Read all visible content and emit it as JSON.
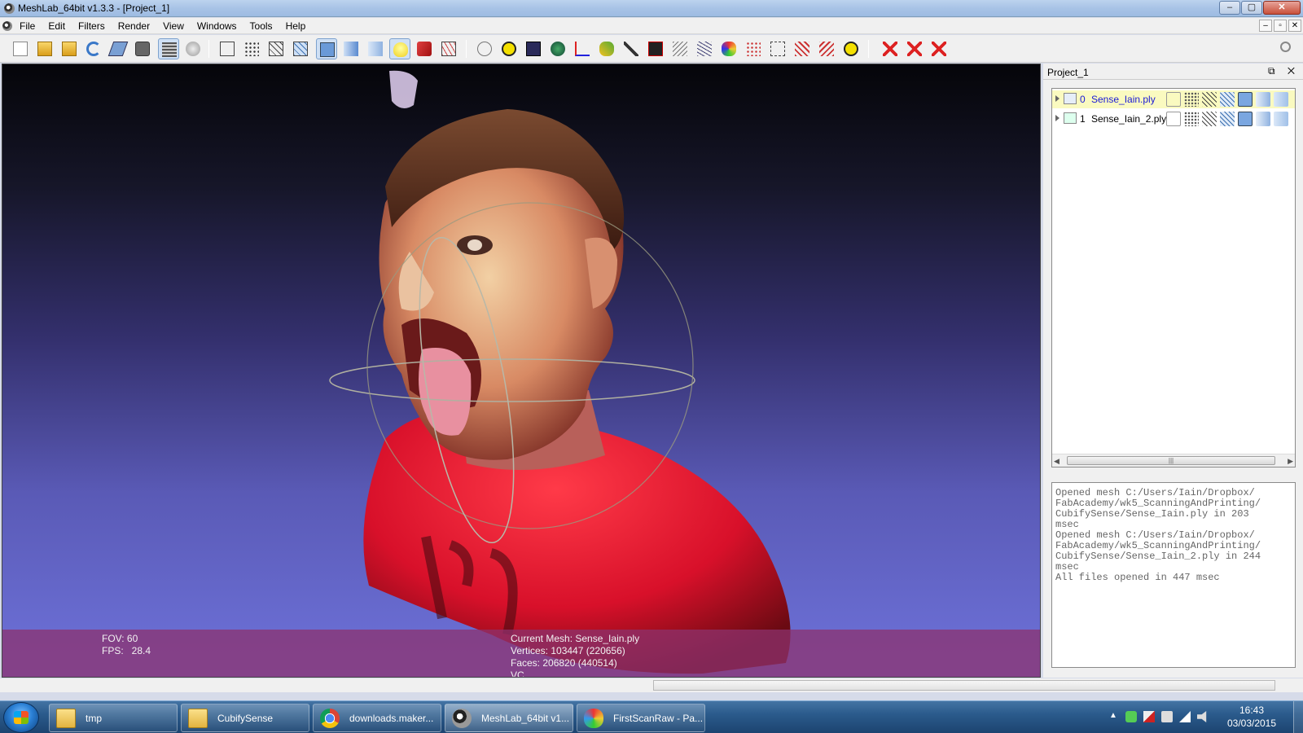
{
  "window": {
    "title": "MeshLab_64bit v1.3.3 - [Project_1]",
    "min": "–",
    "max": "▢",
    "close": "✕"
  },
  "menu": {
    "items": [
      "File",
      "Edit",
      "Filters",
      "Render",
      "View",
      "Windows",
      "Tools",
      "Help"
    ],
    "mdi": [
      "–",
      "▫",
      "✕"
    ]
  },
  "viewport": {
    "fov_label": "FOV: 60",
    "fps_label": "FPS:   28.4",
    "current_mesh": "Current Mesh: Sense_Iain.ply",
    "vertices": "Vertices: 103447 (220656)",
    "faces": "Faces: 206820 (440514)",
    "vc": "VC"
  },
  "panel": {
    "title": "Project_1",
    "buttons": "⧉ ✕",
    "layers": [
      {
        "index": "0",
        "name": "Sense_Iain.ply",
        "selected": true
      },
      {
        "index": "1",
        "name": "Sense_Iain_2.ply",
        "selected": false
      }
    ],
    "scroll_left": "◀",
    "scroll_right": "▶",
    "scroll_grip": "|||",
    "log": [
      "Opened mesh C:/Users/Iain/Dropbox/",
      "FabAcademy/wk5_ScanningAndPrinting/",
      "CubifySense/Sense_Iain.ply in 203",
      "msec",
      "Opened mesh C:/Users/Iain/Dropbox/",
      "FabAcademy/wk5_ScanningAndPrinting/",
      "CubifySense/Sense_Iain_2.ply in 244",
      "msec",
      "All files opened in 447 msec"
    ]
  },
  "taskbar": {
    "tasks": [
      {
        "label": "tmp",
        "icon": "folder-icon"
      },
      {
        "label": "CubifySense",
        "icon": "folder-icon"
      },
      {
        "label": "downloads.maker...",
        "icon": "chrome-icon"
      },
      {
        "label": "MeshLab_64bit v1...",
        "icon": "meshlab-icon"
      },
      {
        "label": "FirstScanRaw - Pa...",
        "icon": "paint-icon"
      }
    ],
    "tray_expand": "▲",
    "time": "16:43",
    "date": "03/03/2015"
  },
  "colors": {
    "viewport_bottom": "#6e72da",
    "info_bar": "#8c326e",
    "selected_layer": "#fafac0"
  }
}
